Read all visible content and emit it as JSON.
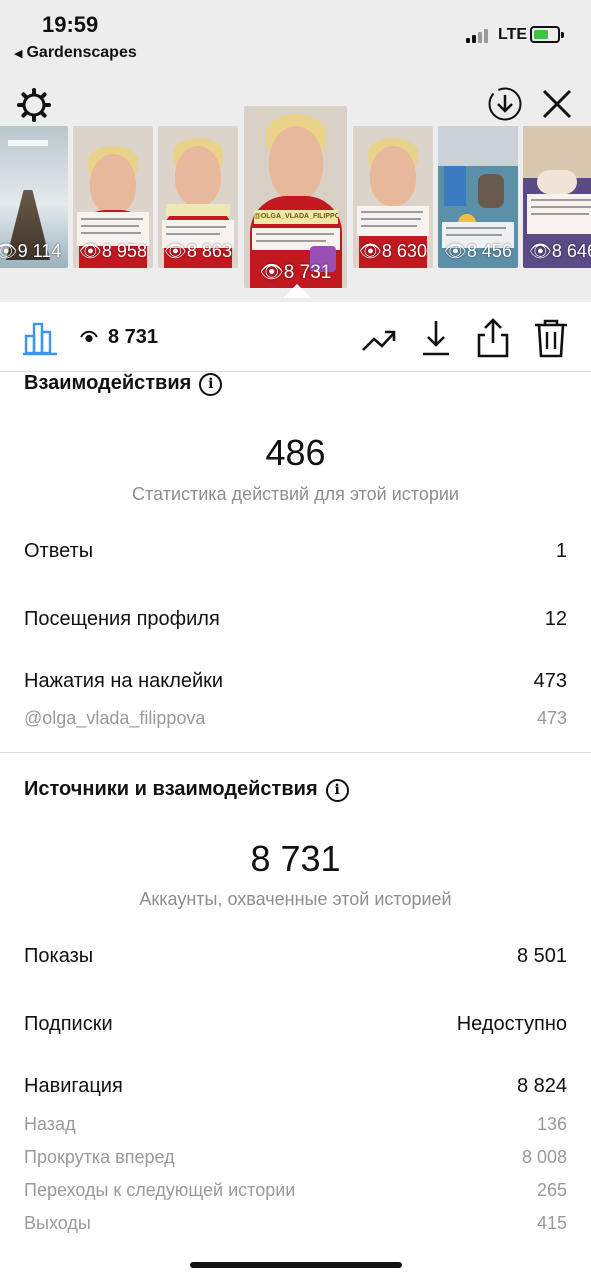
{
  "status_bar": {
    "time": "19:59",
    "back_app": "Gardenscapes",
    "network": "LTE"
  },
  "stories": [
    {
      "views": "9 114",
      "kind": "pier"
    },
    {
      "views": "8 958",
      "kind": "portrait"
    },
    {
      "views": "8 863",
      "kind": "portrait"
    },
    {
      "views": "8 731",
      "kind": "portrait",
      "selected": true,
      "sticker": "@OLGA_VLADA_FILIPPOVA"
    },
    {
      "views": "8 630",
      "kind": "portrait"
    },
    {
      "views": "8 456",
      "kind": "gym"
    },
    {
      "views": "8 646",
      "kind": "bed"
    }
  ],
  "toolbar": {
    "views": "8 731"
  },
  "interactions": {
    "title": "Взаимодействия",
    "total": "486",
    "subtitle": "Статистика действий для этой истории",
    "rows": [
      {
        "label": "Ответы",
        "value": "1"
      },
      {
        "label": "Посещения профиля",
        "value": "12"
      },
      {
        "label": "Нажатия на наклейки",
        "value": "473"
      }
    ],
    "sticker_row": {
      "label": "@olga_vlada_filippova",
      "value": "473"
    }
  },
  "discovery": {
    "title": "Источники и взаимодействия",
    "total": "8 731",
    "subtitle": "Аккаунты, охваченные этой историей",
    "rows": [
      {
        "label": "Показы",
        "value": "8 501"
      },
      {
        "label": "Подписки",
        "value": "Недоступно"
      },
      {
        "label": "Навигация",
        "value": "8 824"
      }
    ],
    "navigation": [
      {
        "label": "Назад",
        "value": "136"
      },
      {
        "label": "Прокрутка вперед",
        "value": "8 008"
      },
      {
        "label": "Переходы к следующей истории",
        "value": "265"
      },
      {
        "label": "Выходы",
        "value": "415"
      }
    ]
  },
  "colors": {
    "accent_blue": "#3897f0",
    "story_red": "#c2181f",
    "muted_text": "#8e8e8e"
  }
}
